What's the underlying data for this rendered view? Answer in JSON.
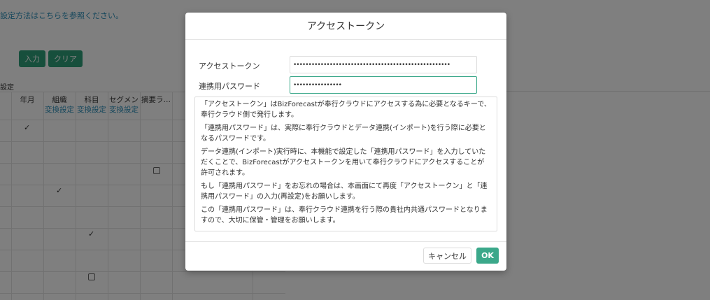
{
  "background": {
    "help_text": "設定方法はこちらを参照ください。",
    "buttons": {
      "input": "入力",
      "clear": "クリア"
    },
    "section_label": "設定",
    "table": {
      "headers": [
        {
          "main": "年月",
          "sub": ""
        },
        {
          "main": "組織",
          "sub": "変換設定"
        },
        {
          "main": "科目",
          "sub": "変換設定"
        },
        {
          "main": "セグメン",
          "sub": "変換設定"
        },
        {
          "main": "摘要ラ…",
          "sub": ""
        }
      ],
      "check_mark": "✓"
    }
  },
  "modal": {
    "title": "アクセストークン",
    "fields": {
      "access_token": {
        "label": "アクセストークン",
        "value": "••••••••••••••••••••••••••••••••••••••••••••••••••••"
      },
      "password": {
        "label": "連携用パスワード",
        "value": "••••••••••••••••"
      }
    },
    "info": [
      "「アクセストークン」はBizForecastが奉行クラウドにアクセスする為に必要となるキーで、奉行クラウド側で発行します。",
      "「連携用パスワード」は、実際に奉行クラウドとデータ連携(インポート)を行う際に必要となるパスワードです。",
      "データ連携(インポート)実行時に、本機能で設定した「連携用パスワード」を入力していただくことで、BizForecastがアクセストークンを用いて奉行クラウドにアクセスすることが許可されます。",
      "もし「連携用パスワード」をお忘れの場合は、本画面にて再度「アクセストークン」と「連携用パスワード」の入力(再設定)をお願いします。",
      "この「連携用パスワード」は、奉行クラウド連携を行う際の貴社内共通パスワードとなりますので、大切に保管・管理をお願いします。"
    ],
    "buttons": {
      "cancel": "キャンセル",
      "ok": "OK"
    }
  },
  "colors": {
    "primary": "#3ba88a",
    "link": "#2d8fb8"
  }
}
